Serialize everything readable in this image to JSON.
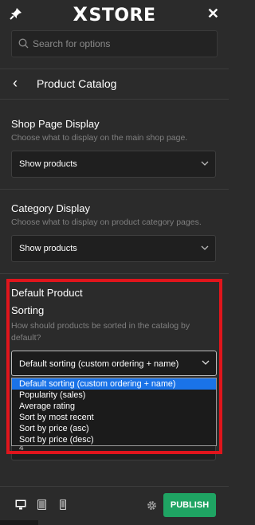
{
  "brand": {
    "logo_text": "STORE",
    "logo_mark": "X"
  },
  "search": {
    "placeholder": "Search for options",
    "value": ""
  },
  "header": {
    "title": "Product Catalog"
  },
  "sections": [
    {
      "title": "Shop Page Display",
      "description": "Choose what to display on the main shop page.",
      "value": "Show products"
    },
    {
      "title": "Category Display",
      "description": "Choose what to display on product category pages.",
      "value": "Show products"
    }
  ],
  "sorting": {
    "title_line1": "Default Product",
    "title_line2": "Sorting",
    "description": "How should products be sorted in the catalog by default?",
    "value": "Default sorting (custom ordering + name)",
    "options": [
      "Default sorting (custom ordering + name)",
      "Popularity (sales)",
      "Average rating",
      "Sort by most recent",
      "Sort by price (asc)",
      "Sort by price (desc)"
    ],
    "selected_index": 0
  },
  "peek_value": "4",
  "footer": {
    "publish_label": "PUBLISH"
  },
  "colors": {
    "accent_publish": "#1fa463",
    "highlight_border": "#e0151c",
    "selected_option": "#1a73e8"
  },
  "icons": [
    "pin-icon",
    "close-icon",
    "search-icon",
    "back-chevron-icon",
    "chevron-down-icon",
    "desktop-icon",
    "tablet-icon",
    "mobile-icon",
    "gear-icon"
  ]
}
